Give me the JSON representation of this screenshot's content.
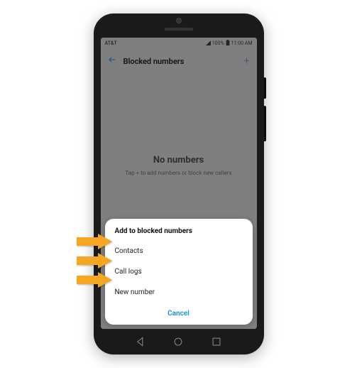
{
  "status_bar": {
    "carrier": "AT&T",
    "signal_text": "100%",
    "time": "11:00 AM"
  },
  "header": {
    "title": "Blocked numbers",
    "add_symbol": "+"
  },
  "empty_state": {
    "title": "No numbers",
    "subtitle": "Tap + to add numbers or block new callers"
  },
  "sheet": {
    "title": "Add to blocked numbers",
    "options": [
      "Contacts",
      "Call logs",
      "New number"
    ],
    "cancel": "Cancel"
  }
}
